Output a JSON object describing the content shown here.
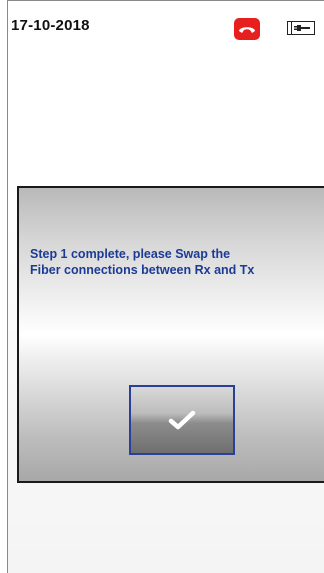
{
  "status_bar": {
    "date": "17-10-2018",
    "call_icon": "phone-hangup-icon",
    "call_icon_color": "#e81f1f",
    "power_icon": "battery-plug-icon"
  },
  "dialog": {
    "message_line1": "Step 1 complete, please Swap the",
    "message_line2": "Fiber connections between Rx and Tx",
    "message_color": "#1c3b96",
    "confirm_icon": "checkmark-icon",
    "button_border_color": "#2a3f9a"
  }
}
